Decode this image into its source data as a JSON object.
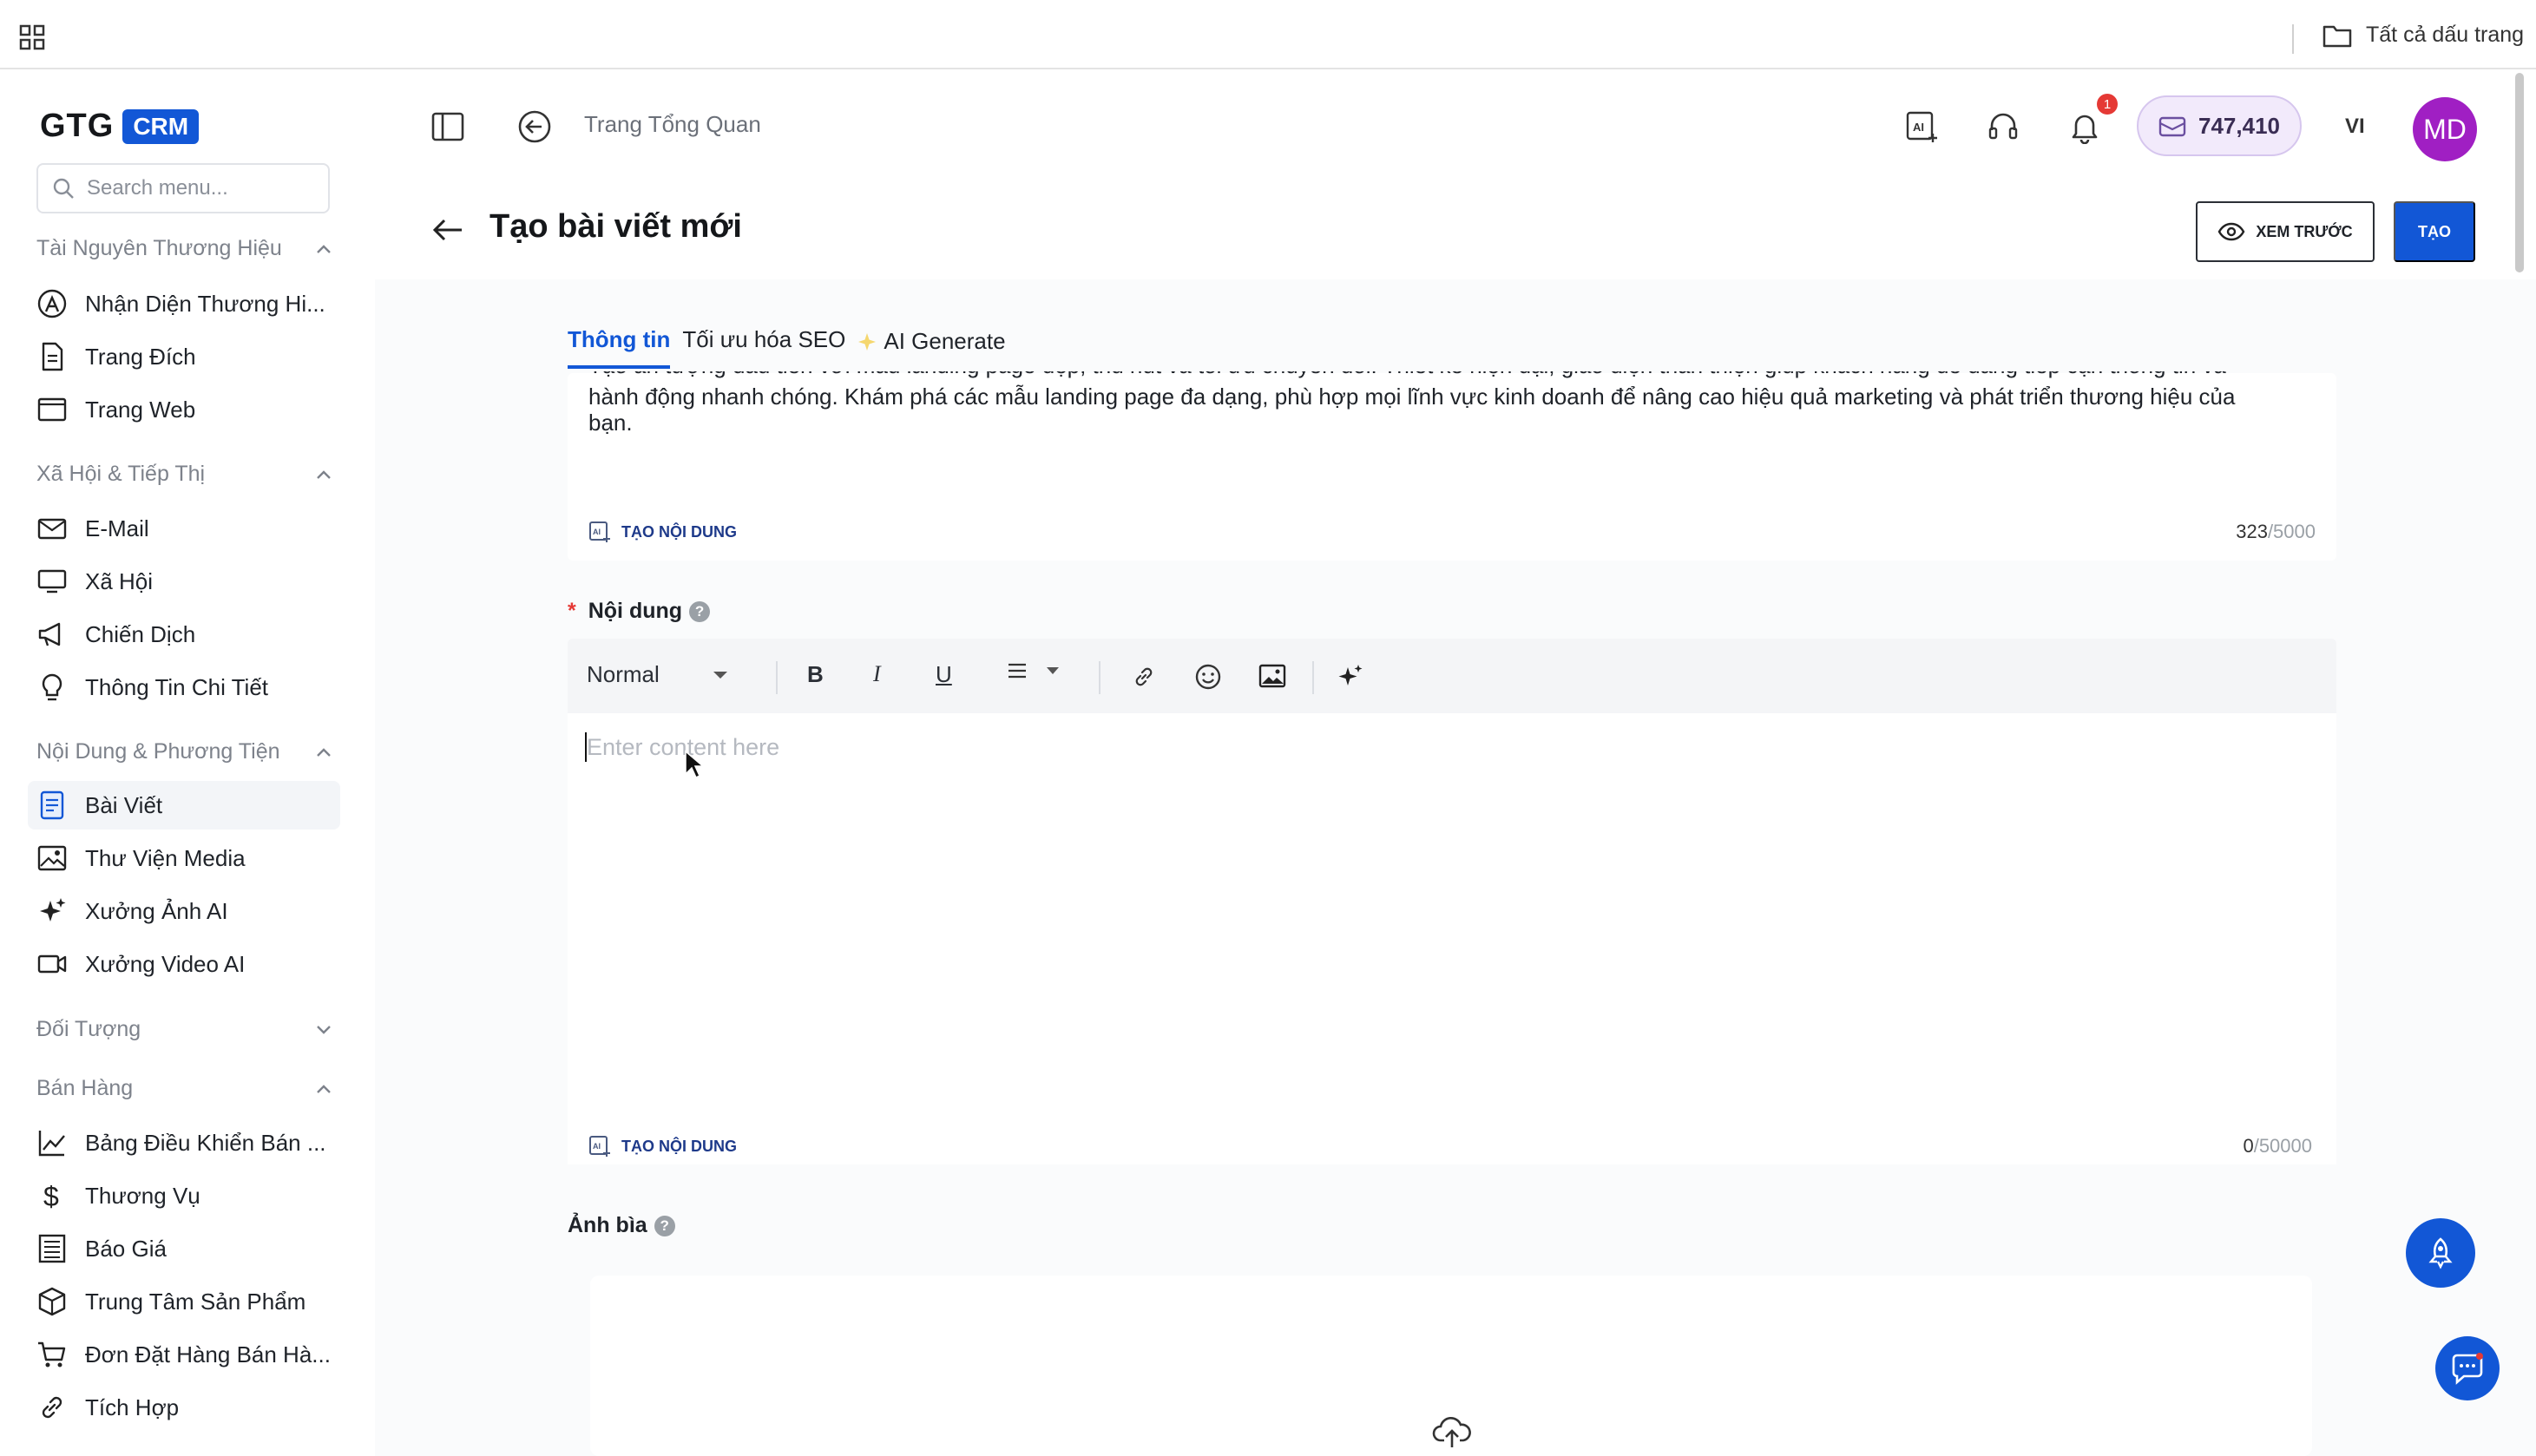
{
  "browser": {
    "all_bookmarks": "Tất cả dấu trang"
  },
  "sidebar": {
    "logo_text": "GTG",
    "logo_badge": "CRM",
    "search_placeholder": "Search menu...",
    "sections": [
      {
        "title": "Tài Nguyên Thương Hiệu",
        "items": [
          "Nhận Diện Thương Hi...",
          "Trang Đích",
          "Trang Web"
        ]
      },
      {
        "title": "Xã Hội & Tiếp Thị",
        "items": [
          "E-Mail",
          "Xã Hội",
          "Chiến Dịch",
          "Thông Tin Chi Tiết"
        ]
      },
      {
        "title": "Nội Dung & Phương Tiện",
        "items": [
          "Bài Viết",
          "Thư Viện Media",
          "Xưởng Ảnh AI",
          "Xưởng Video AI"
        ]
      },
      {
        "title": "Đối Tượng",
        "items": []
      },
      {
        "title": "Bán Hàng",
        "items": [
          "Bảng Điều Khiển Bán ...",
          "Thương Vụ",
          "Báo Giá",
          "Trung Tâm Sản Phẩm",
          "Đơn Đặt Hàng Bán Hà...",
          "Tích Hợp"
        ]
      }
    ],
    "active_item": "Bài Viết"
  },
  "header": {
    "breadcrumb": "Trang Tổng Quan",
    "notification_count": "1",
    "balance": "747,410",
    "language": "VI",
    "avatar_initials": "MD"
  },
  "page": {
    "title": "Tạo bài viết mới",
    "preview_button": "XEM TRƯỚC",
    "create_button": "TẠO"
  },
  "tabs": [
    "Thông tin",
    "Tối ưu hóa SEO",
    "AI Generate"
  ],
  "active_tab": "Thông tin",
  "description": {
    "line1": "Tạo ấn tượng đầu tiên với mẫu landing page đẹp, thu hút và tối ưu chuyển đổi. Thiết kế hiện đại, giao diện thân thiện giúp khách hàng dễ dàng tiếp cận thông tin và",
    "line2": "hành động nhanh chóng. Khám phá các mẫu landing page đa dạng, phù hợp mọi lĩnh vực kinh doanh để nâng cao hiệu quả marketing và phát triển thương hiệu của",
    "line3": "bạn.",
    "generate_label": "TẠO NỘI DUNG",
    "count": "323",
    "max": "/5000"
  },
  "content_field": {
    "label": "Nội dung",
    "format_select": "Normal",
    "placeholder": "Enter content here",
    "generate_label": "TẠO NỘI DUNG",
    "count": "0",
    "max": "/50000"
  },
  "cover_field": {
    "label": "Ảnh bìa"
  },
  "colors": {
    "primary": "#1257d6",
    "avatar": "#a01fc3",
    "badge": "#e53935"
  }
}
